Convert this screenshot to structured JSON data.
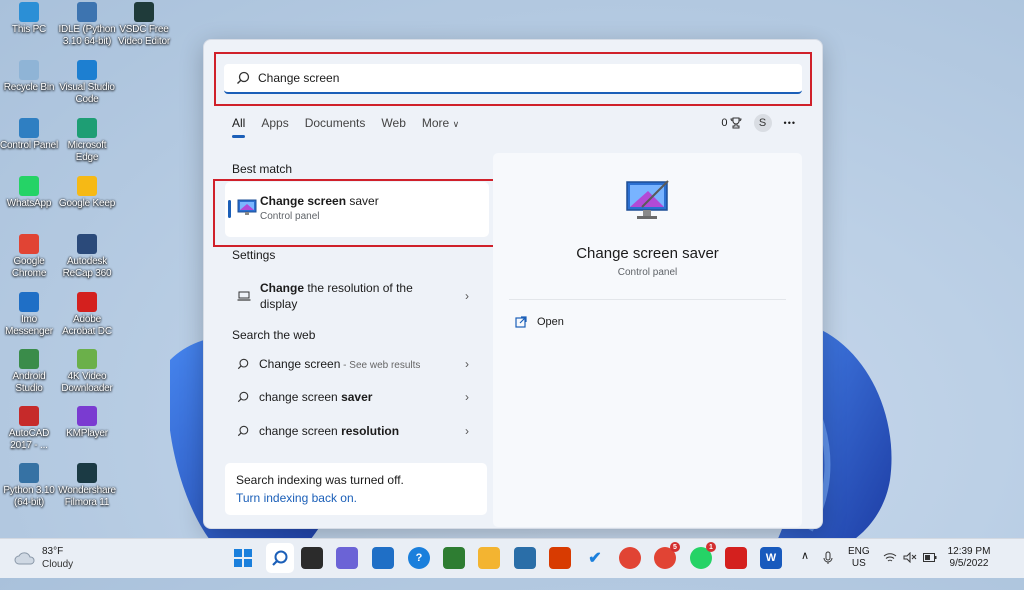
{
  "desktop": {
    "icons": [
      {
        "label": "This PC",
        "icon": "monitor-icon",
        "color": "#2b8fd6"
      },
      {
        "label": "IDLE (Python 3.10 64-bit)",
        "icon": "python-idle-icon",
        "color": "#3d74b0"
      },
      {
        "label": "VSDC Free Video Editor",
        "icon": "vsdc-icon",
        "color": "#1f3b3a"
      },
      {
        "label": "Recycle Bin",
        "icon": "recycle-bin-icon",
        "color": "#8fb4d6"
      },
      {
        "label": "Visual Studio Code",
        "icon": "vscode-icon",
        "color": "#1d7fd1"
      },
      {
        "label": "Control Panel",
        "icon": "control-panel-icon",
        "color": "#2f7fc2"
      },
      {
        "label": "Microsoft Edge",
        "icon": "edge-icon",
        "color": "#1e9e74"
      },
      {
        "label": "WhatsApp",
        "icon": "whatsapp-icon",
        "color": "#25d366"
      },
      {
        "label": "Google Keep",
        "icon": "google-keep-icon",
        "color": "#f6b915"
      },
      {
        "label": "Google Chrome",
        "icon": "chrome-icon",
        "color": "#e14434"
      },
      {
        "label": "Autodesk ReCap 360",
        "icon": "recap-icon",
        "color": "#2b4a7a"
      },
      {
        "label": "Imo Messenger",
        "icon": "imo-icon",
        "color": "#1f6fc6"
      },
      {
        "label": "Adobe Acrobat DC",
        "icon": "acrobat-icon",
        "color": "#d4201e"
      },
      {
        "label": "Android Studio",
        "icon": "android-studio-icon",
        "color": "#3a8c4a"
      },
      {
        "label": "4K Video Downloader",
        "icon": "4k-downloader-icon",
        "color": "#6bb04a"
      },
      {
        "label": "AutoCAD 2017 - ...",
        "icon": "autocad-icon",
        "color": "#c62a2a"
      },
      {
        "label": "KMPlayer",
        "icon": "kmplayer-icon",
        "color": "#7a3bd1"
      },
      {
        "label": "Python 3.10 (64-bit)",
        "icon": "python-icon",
        "color": "#3672a4"
      },
      {
        "label": "Wondershare Filmora 11",
        "icon": "filmora-icon",
        "color": "#1b3a44"
      }
    ]
  },
  "search": {
    "query": "Change screen",
    "tabs": [
      "All",
      "Apps",
      "Documents",
      "Web",
      "More"
    ],
    "rewards_count": "0",
    "avatar_initial": "S",
    "more_options": "•••",
    "best_match_heading": "Best match",
    "best_match": {
      "title_bold": "Change screen",
      "title_rest": " saver",
      "subtitle": "Control panel"
    },
    "settings_heading": "Settings",
    "settings_item": {
      "bold": "Change",
      "rest": " the resolution of the display"
    },
    "web_heading": "Search the web",
    "web_items": [
      {
        "normal": "Change screen",
        "bold": "",
        "suffix": " - See web results"
      },
      {
        "normal": "change screen ",
        "bold": "saver",
        "suffix": ""
      },
      {
        "normal": "change screen ",
        "bold": "resolution",
        "suffix": ""
      }
    ],
    "indexing_text": "Search indexing was turned off.",
    "indexing_link": "Turn indexing back on.",
    "detail": {
      "title": "Change screen saver",
      "subtitle": "Control panel",
      "action": "Open"
    }
  },
  "taskbar": {
    "weather_temp": "83°F",
    "weather_desc": "Cloudy",
    "lang_top": "ENG",
    "lang_bottom": "US",
    "time": "12:39 PM",
    "date": "9/5/2022",
    "chrome_badge": "5",
    "whatsapp_badge": "1"
  },
  "colors": {
    "accent": "#1b5fb8",
    "highlight": "#d0202a"
  }
}
